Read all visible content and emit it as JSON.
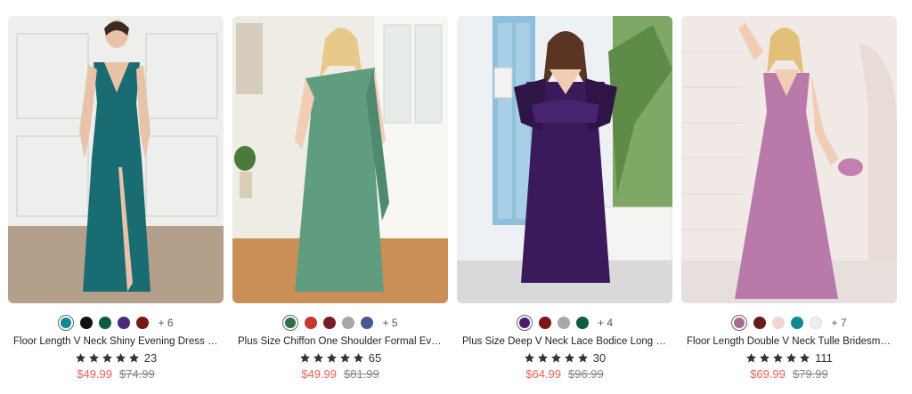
{
  "products": [
    {
      "title": "Floor Length V Neck Shiny Evening Dress with...",
      "swatches": [
        "#0f8a93",
        "#111111",
        "#0e5b3e",
        "#4a2a7a",
        "#7a1616"
      ],
      "more": "+ 6",
      "rating_count": "23",
      "sale_price": "$49.99",
      "original_price": "$74.99",
      "dress_color": "#1a6c73",
      "bg_color": "#ececea"
    },
    {
      "title": "Plus Size Chiffon One Shoulder Formal Evening...",
      "swatches": [
        "#2f6e4a",
        "#c43a2a",
        "#761d24",
        "#a7a7a7",
        "#465a92"
      ],
      "more": "+ 5",
      "rating_count": "65",
      "sale_price": "$49.99",
      "original_price": "$81.99",
      "dress_color": "#5f9c80",
      "bg_color": "#efece6"
    },
    {
      "title": "Plus Size Deep V Neck Lace Bodice Long Flowy...",
      "swatches": [
        "#4a1d6e",
        "#7a1616",
        "#a7a7a7",
        "#0e5b3e"
      ],
      "more": "+ 4",
      "rating_count": "30",
      "sale_price": "$64.99",
      "original_price": "$96.99",
      "dress_color": "#3a1a5a",
      "bg_color": "#e9eef2"
    },
    {
      "title": "Floor Length Double V Neck Tulle Bridesmaid...",
      "swatches": [
        "#a86a8e",
        "#6a1a1e",
        "#f4d4d2",
        "#108a8e",
        "#ededed"
      ],
      "more": "+ 7",
      "rating_count": "111",
      "sale_price": "$69.99",
      "original_price": "$79.99",
      "dress_color": "#b97aaa",
      "bg_color": "#f1e9e6"
    }
  ],
  "colors": {
    "sale": "#e8625a",
    "star": "#333333"
  }
}
